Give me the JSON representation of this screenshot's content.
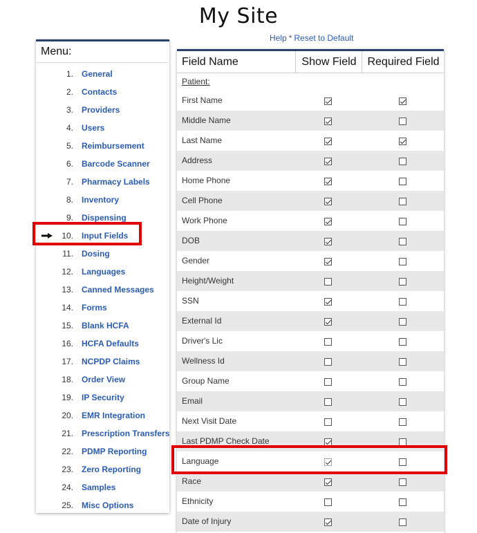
{
  "page": {
    "title": "My Site",
    "help_link": "Help",
    "separator": "*",
    "reset_link": "Reset to Default"
  },
  "menu": {
    "header": "Menu:",
    "items": [
      {
        "num": "1.",
        "label": "General"
      },
      {
        "num": "2.",
        "label": "Contacts"
      },
      {
        "num": "3.",
        "label": "Providers"
      },
      {
        "num": "4.",
        "label": "Users"
      },
      {
        "num": "5.",
        "label": "Reimbursement"
      },
      {
        "num": "6.",
        "label": "Barcode Scanner"
      },
      {
        "num": "7.",
        "label": "Pharmacy Labels"
      },
      {
        "num": "8.",
        "label": "Inventory"
      },
      {
        "num": "9.",
        "label": "Dispensing"
      },
      {
        "num": "10.",
        "label": "Input Fields",
        "current": true
      },
      {
        "num": "11.",
        "label": "Dosing"
      },
      {
        "num": "12.",
        "label": "Languages"
      },
      {
        "num": "13.",
        "label": "Canned Messages"
      },
      {
        "num": "14.",
        "label": "Forms"
      },
      {
        "num": "15.",
        "label": "Blank HCFA"
      },
      {
        "num": "16.",
        "label": "HCFA Defaults"
      },
      {
        "num": "17.",
        "label": "NCPDP Claims"
      },
      {
        "num": "18.",
        "label": "Order View"
      },
      {
        "num": "19.",
        "label": "IP Security"
      },
      {
        "num": "20.",
        "label": "EMR Integration"
      },
      {
        "num": "21.",
        "label": "Prescription Transfers"
      },
      {
        "num": "22.",
        "label": "PDMP Reporting"
      },
      {
        "num": "23.",
        "label": "Zero Reporting"
      },
      {
        "num": "24.",
        "label": "Samples"
      },
      {
        "num": "25.",
        "label": "Misc Options"
      }
    ]
  },
  "fields_table": {
    "headers": {
      "name": "Field Name",
      "show": "Show Field",
      "required": "Required Field"
    },
    "section": "Patient:",
    "rows": [
      {
        "name": "First Name",
        "show": true,
        "required": true
      },
      {
        "name": "Middle Name",
        "show": true,
        "required": false
      },
      {
        "name": "Last Name",
        "show": true,
        "required": true
      },
      {
        "name": "Address",
        "show": true,
        "required": false
      },
      {
        "name": "Home Phone",
        "show": true,
        "required": false
      },
      {
        "name": "Cell Phone",
        "show": true,
        "required": false
      },
      {
        "name": "Work Phone",
        "show": true,
        "required": false
      },
      {
        "name": "DOB",
        "show": true,
        "required": false
      },
      {
        "name": "Gender",
        "show": true,
        "required": false
      },
      {
        "name": "Height/Weight",
        "show": false,
        "required": false
      },
      {
        "name": "SSN",
        "show": true,
        "required": false
      },
      {
        "name": "External Id",
        "show": true,
        "required": false
      },
      {
        "name": "Driver's Lic",
        "show": false,
        "required": false
      },
      {
        "name": "Wellness Id",
        "show": false,
        "required": false
      },
      {
        "name": "Group Name",
        "show": false,
        "required": false
      },
      {
        "name": "Email",
        "show": false,
        "required": false
      },
      {
        "name": "Next Visit Date",
        "show": false,
        "required": false
      },
      {
        "name": "Last PDMP Check Date",
        "show": true,
        "required": false
      },
      {
        "name": "Language",
        "show": true,
        "required": false,
        "focused": true
      },
      {
        "name": "Race",
        "show": true,
        "required": false
      },
      {
        "name": "Ethnicity",
        "show": false,
        "required": false
      },
      {
        "name": "Date of Injury",
        "show": true,
        "required": false
      }
    ]
  },
  "colors": {
    "link": "#2a5cb5",
    "header_bar": "#2b3f6b",
    "highlight": "#e00000",
    "row_alt": "#e8e8e8"
  },
  "icons": {
    "current_menu_marker": "right-arrow-icon",
    "checkbox": "checkbox-icon"
  }
}
